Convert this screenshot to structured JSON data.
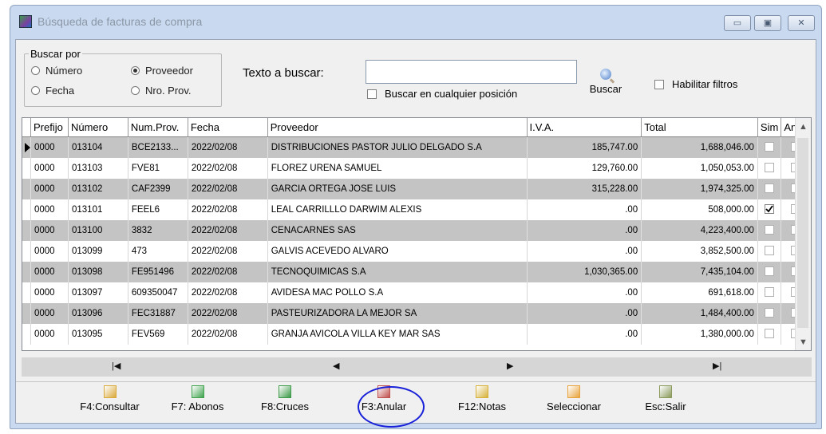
{
  "window": {
    "title": "Búsqueda de facturas de compra",
    "controls": [
      "▭",
      "▣",
      "✕"
    ]
  },
  "search": {
    "group_label": "Buscar por",
    "options": [
      {
        "label": "Número",
        "selected": false
      },
      {
        "label": "Proveedor",
        "selected": true
      },
      {
        "label": "Fecha",
        "selected": false
      },
      {
        "label": "Nro. Prov.",
        "selected": false
      }
    ],
    "text_label": "Texto a buscar:",
    "text_value": "",
    "any_position_label": "Buscar en cualquier posición",
    "any_position_checked": false,
    "search_button": "Buscar",
    "filters_label": "Habilitar filtros",
    "filters_checked": false
  },
  "grid": {
    "columns": [
      "Prefijo",
      "Número",
      "Num.Prov.",
      "Fecha",
      "Proveedor",
      "I.V.A.",
      "Total",
      "Sim",
      "Anul."
    ],
    "rows": [
      {
        "prefijo": "0000",
        "numero": "013104",
        "numprov": "BCE2133...",
        "fecha": "2022/02/08",
        "proveedor": "DISTRIBUCIONES PASTOR JULIO DELGADO S.A",
        "iva": "185,747.00",
        "total": "1,688,046.00",
        "sim": false,
        "anul": false,
        "current": true
      },
      {
        "prefijo": "0000",
        "numero": "013103",
        "numprov": "FVE81",
        "fecha": "2022/02/08",
        "proveedor": "FLOREZ URENA SAMUEL",
        "iva": "129,760.00",
        "total": "1,050,053.00",
        "sim": false,
        "anul": false,
        "current": false
      },
      {
        "prefijo": "0000",
        "numero": "013102",
        "numprov": "CAF2399",
        "fecha": "2022/02/08",
        "proveedor": "GARCIA ORTEGA JOSE LUIS",
        "iva": "315,228.00",
        "total": "1,974,325.00",
        "sim": false,
        "anul": false,
        "current": false
      },
      {
        "prefijo": "0000",
        "numero": "013101",
        "numprov": "FEEL6",
        "fecha": "2022/02/08",
        "proveedor": "LEAL CARRILLLO DARWIM ALEXIS",
        "iva": ".00",
        "total": "508,000.00",
        "sim": true,
        "anul": false,
        "current": false
      },
      {
        "prefijo": "0000",
        "numero": "013100",
        "numprov": "3832",
        "fecha": "2022/02/08",
        "proveedor": "CENACARNES SAS",
        "iva": ".00",
        "total": "4,223,400.00",
        "sim": false,
        "anul": false,
        "current": false
      },
      {
        "prefijo": "0000",
        "numero": "013099",
        "numprov": "473",
        "fecha": "2022/02/08",
        "proveedor": "GALVIS ACEVEDO ALVARO",
        "iva": ".00",
        "total": "3,852,500.00",
        "sim": false,
        "anul": false,
        "current": false
      },
      {
        "prefijo": "0000",
        "numero": "013098",
        "numprov": "FE951496",
        "fecha": "2022/02/08",
        "proveedor": "TECNOQUIMICAS S.A",
        "iva": "1,030,365.00",
        "total": "7,435,104.00",
        "sim": false,
        "anul": false,
        "current": false
      },
      {
        "prefijo": "0000",
        "numero": "013097",
        "numprov": "609350047",
        "fecha": "2022/02/08",
        "proveedor": "AVIDESA MAC POLLO S.A",
        "iva": ".00",
        "total": "691,618.00",
        "sim": false,
        "anul": false,
        "current": false
      },
      {
        "prefijo": "0000",
        "numero": "013096",
        "numprov": "FEC31887",
        "fecha": "2022/02/08",
        "proveedor": "PASTEURIZADORA LA MEJOR SA",
        "iva": ".00",
        "total": "1,484,400.00",
        "sim": false,
        "anul": false,
        "current": false
      },
      {
        "prefijo": "0000",
        "numero": "013095",
        "numprov": "FEV569",
        "fecha": "2022/02/08",
        "proveedor": "GRANJA AVICOLA VILLA KEY MAR SAS",
        "iva": ".00",
        "total": "1,380,000.00",
        "sim": false,
        "anul": false,
        "current": false
      }
    ]
  },
  "navigator": {
    "first": "|◀",
    "prev": "◀",
    "next": "▶",
    "last": "▶|"
  },
  "toolbar": [
    {
      "label": "F4:Consultar",
      "icon": "document-edit-icon",
      "color": "#d9a93a"
    },
    {
      "label": "F7: Abonos",
      "icon": "money-icon",
      "color": "#3fa34d"
    },
    {
      "label": "F8:Cruces",
      "icon": "cross-arrows-icon",
      "color": "#3c9a48"
    },
    {
      "label": "F3:Anular",
      "icon": "cancel-document-icon",
      "color": "#c0504d"
    },
    {
      "label": "F12:Notas",
      "icon": "note-add-icon",
      "color": "#d6b23a"
    },
    {
      "label": "Seleccionar",
      "icon": "hand-pointer-icon",
      "color": "#e8a33c"
    },
    {
      "label": "Esc:Salir",
      "icon": "exit-door-icon",
      "color": "#8a9a5b"
    }
  ],
  "highlight_color": "#1a22d9"
}
